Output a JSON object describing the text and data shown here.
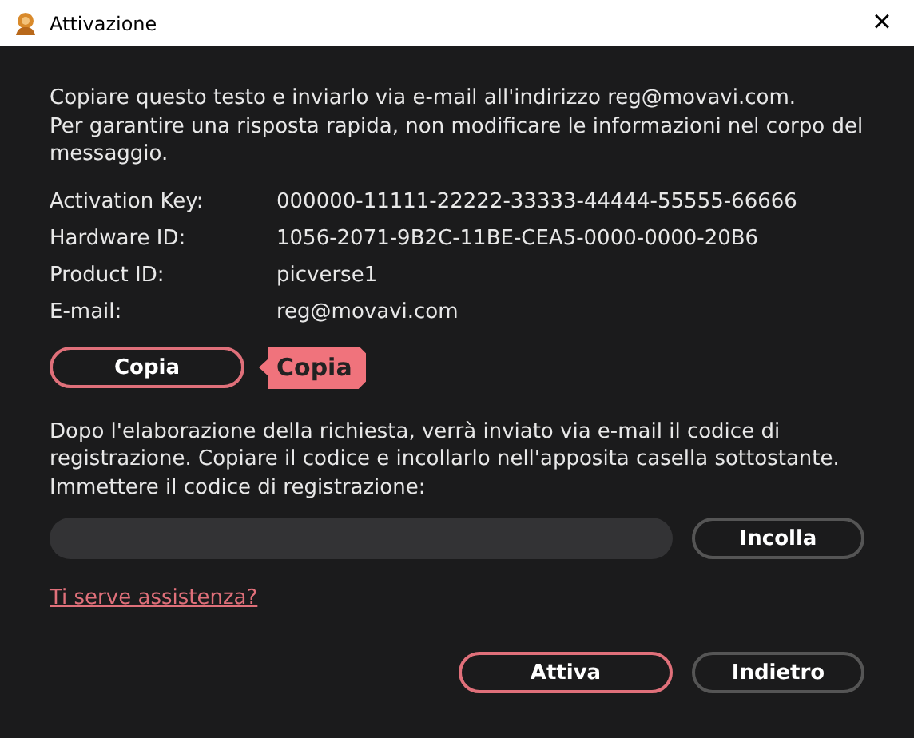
{
  "window": {
    "title": "Attivazione",
    "close": "×"
  },
  "intro": [
    "Copiare questo testo e inviarlo via e-mail all'indirizzo reg@movavi.com.",
    "Per garantire una risposta rapida, non modificare le informazioni nel corpo del messaggio."
  ],
  "fields": [
    {
      "label": "Activation Key:",
      "value": "000000-11111-22222-33333-44444-55555-66666"
    },
    {
      "label": "Hardware ID:",
      "value": "1056-2071-9B2C-11BE-CEA5-0000-0000-20B6"
    },
    {
      "label": "Product ID:",
      "value": "picverse1"
    },
    {
      "label": "E-mail:",
      "value": "reg@movavi.com"
    }
  ],
  "copy_button": {
    "label": "Copia",
    "tooltip": "Copia"
  },
  "instructions": "Dopo l'elaborazione della richiesta, verrà inviato via e-mail il codice di registrazione. Copiare il codice e incollarlo nell'apposita casella sottostante. Immettere il codice di registrazione:",
  "paste_button": "Incolla",
  "help_link": "Ti serve assistenza?",
  "buttons": [
    {
      "label": "Attiva",
      "primary": true
    },
    {
      "label": "Indietro",
      "primary": false
    }
  ]
}
